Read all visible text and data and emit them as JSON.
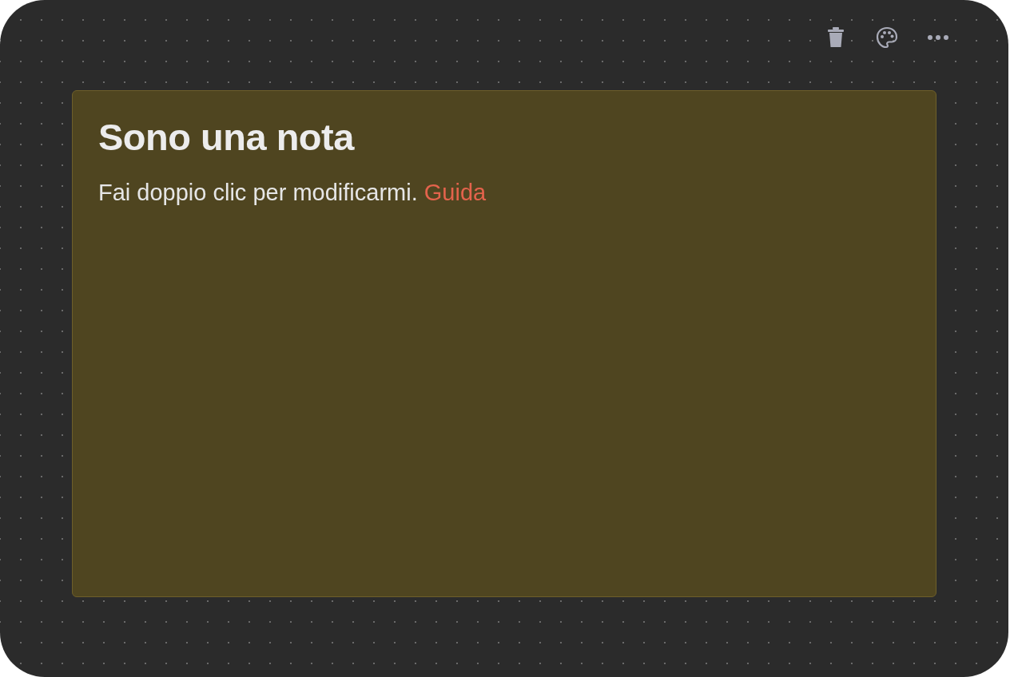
{
  "toolbar": {
    "buttons": [
      {
        "kind": "trash"
      },
      {
        "kind": "palette"
      },
      {
        "kind": "more"
      }
    ]
  },
  "note": {
    "color": "#4f4520",
    "title": "Sono una nota",
    "body": "Fai doppio clic per modificarmi.",
    "link": "Guida"
  }
}
